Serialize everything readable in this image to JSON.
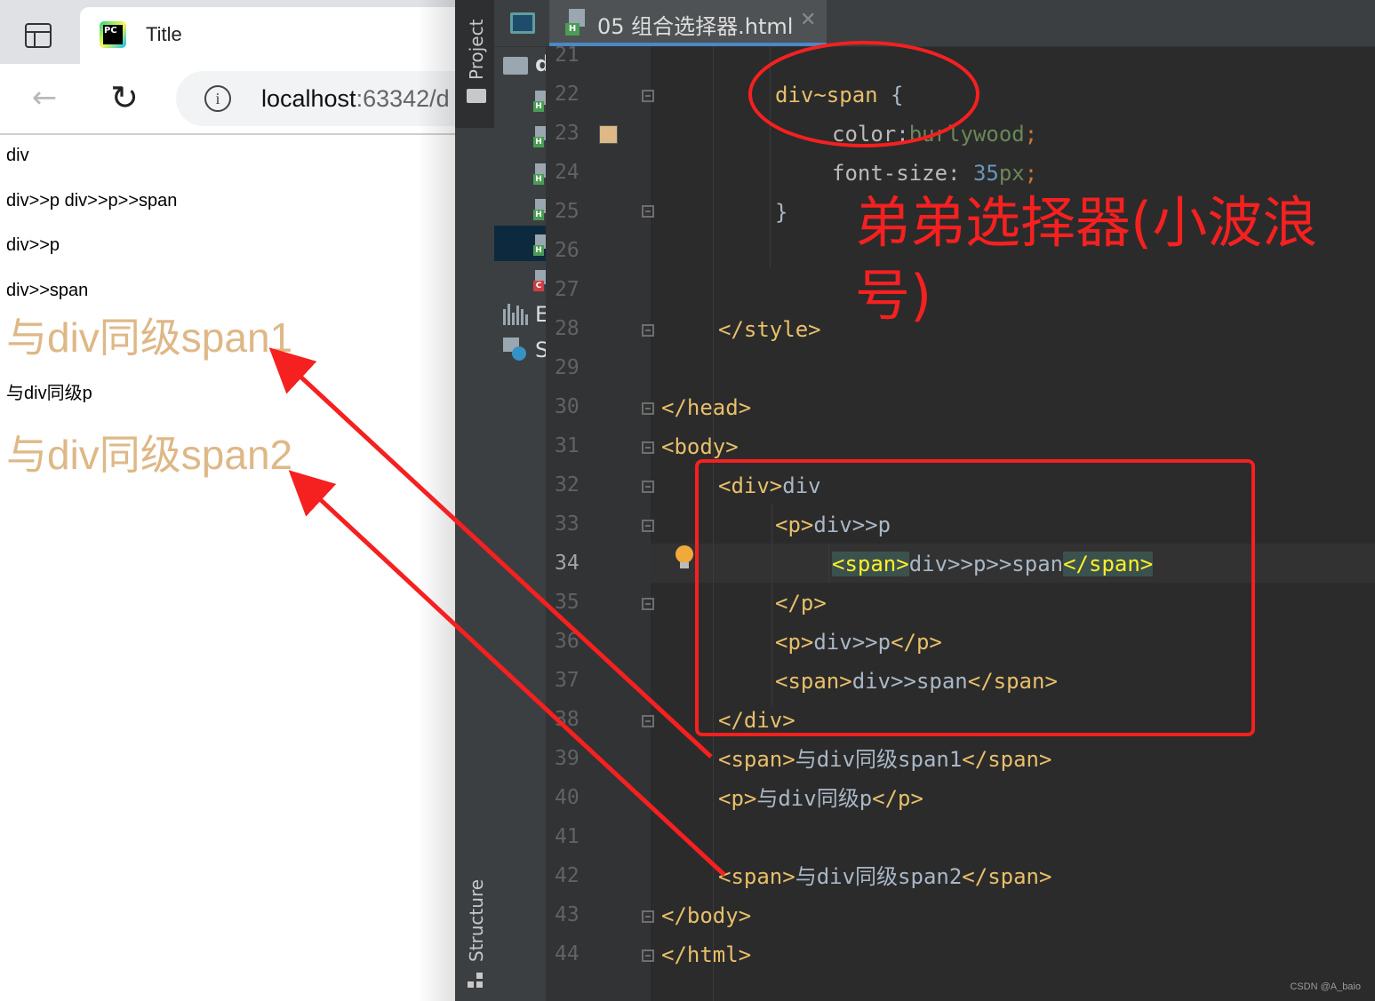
{
  "browser": {
    "tab_title": "Title",
    "tab_icon_text": "PC",
    "url_host": "localhost",
    "url_rest": ":63342/d",
    "info_glyph": "i",
    "icons": {
      "back": "arrow-left-icon",
      "reload": "reload-icon",
      "info": "info-icon",
      "tab_toggle": "tab-sidebar-icon"
    },
    "page_lines": [
      {
        "text": "div",
        "style": "small"
      },
      {
        "text": "div>>p div>>p>>span",
        "style": "small"
      },
      {
        "text": "div>>p",
        "style": "small"
      },
      {
        "text": "div>>span",
        "style": "small"
      },
      {
        "text": "与div同级span1",
        "style": "big"
      },
      {
        "text": "与div同级p",
        "style": "small"
      },
      {
        "text": "与div同级span2",
        "style": "big"
      }
    ],
    "styled_color": "#deb887"
  },
  "ide": {
    "tool_window_project": "Project",
    "tool_window_structure": "Structure",
    "tree_letters": [
      "d",
      "E",
      "S"
    ],
    "file_badge": "H",
    "css_badge": "C",
    "file_tab": "05 组合选择器.html",
    "close_glyph": "✕",
    "line_numbers": [
      "21",
      "22",
      "23",
      "24",
      "25",
      "26",
      "27",
      "28",
      "29",
      "30",
      "31",
      "32",
      "33",
      "34",
      "35",
      "36",
      "37",
      "38",
      "39",
      "40",
      "41",
      "42",
      "43",
      "44"
    ],
    "current_line": "34",
    "code": {
      "l22_selector": "div~span",
      "l22_brace": " {",
      "l23_prop": "color",
      "l23_value": "burlywood",
      "l24_prop": "font-size",
      "l24_num": "35",
      "l24_unit": "px",
      "colon": ":",
      "colon_space": ": ",
      "semi": ";",
      "l25": "}",
      "l28": "</style>",
      "l30": "</head>",
      "l31": "<body>",
      "l32_tag": "<div>",
      "l32_text": "div",
      "l33_tag": "<p>",
      "l33_text": "div>>p",
      "l34_open": "<span>",
      "l34_text": "div>>p>>span",
      "l34_close": "</span>",
      "l35": "</p>",
      "l36_open": "<p>",
      "l36_text": "div>>p",
      "l36_close": "</p>",
      "l37_open": "<span>",
      "l37_text": "div>>span",
      "l37_close": "</span>",
      "l38": "</div>",
      "l39_open": "<span>",
      "l39_text": "与div同级span1",
      "l39_close": "</span>",
      "l40_open": "<p>",
      "l40_text": "与div同级p",
      "l40_close": "</p>",
      "l42_open": "<span>",
      "l42_text": "与div同级span2",
      "l42_close": "</span>",
      "l43": "</body>",
      "l44": "</html>"
    }
  },
  "annotation": {
    "text": "弟弟选择器(小波浪号)",
    "color": "#f52020"
  },
  "watermark": "CSDN @A_baio"
}
